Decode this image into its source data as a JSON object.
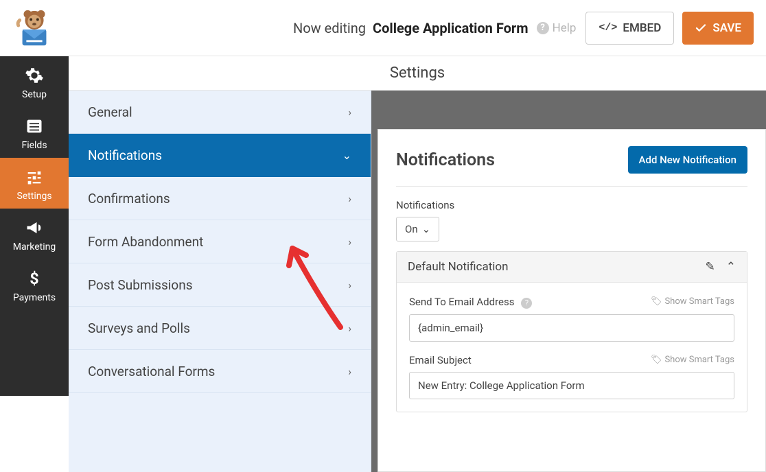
{
  "topbar": {
    "title_prefix": "Now editing",
    "title_name": "College Application Form",
    "help_label": "Help",
    "embed_label": "EMBED",
    "save_label": "SAVE"
  },
  "sidebar": {
    "items": [
      {
        "label": "Setup"
      },
      {
        "label": "Fields"
      },
      {
        "label": "Settings"
      },
      {
        "label": "Marketing"
      },
      {
        "label": "Payments"
      }
    ]
  },
  "section_title": "Settings",
  "submenu": {
    "items": [
      {
        "label": "General"
      },
      {
        "label": "Notifications"
      },
      {
        "label": "Confirmations"
      },
      {
        "label": "Form Abandonment"
      },
      {
        "label": "Post Submissions"
      },
      {
        "label": "Surveys and Polls"
      },
      {
        "label": "Conversational Forms"
      }
    ]
  },
  "panel": {
    "heading": "Notifications",
    "add_button": "Add New Notification",
    "toggle_label": "Notifications",
    "toggle_value": "On",
    "block_title": "Default Notification",
    "field1": {
      "label": "Send To Email Address",
      "smart": "Show Smart Tags",
      "value": "{admin_email}"
    },
    "field2": {
      "label": "Email Subject",
      "smart": "Show Smart Tags",
      "value": "New Entry: College Application Form"
    }
  }
}
